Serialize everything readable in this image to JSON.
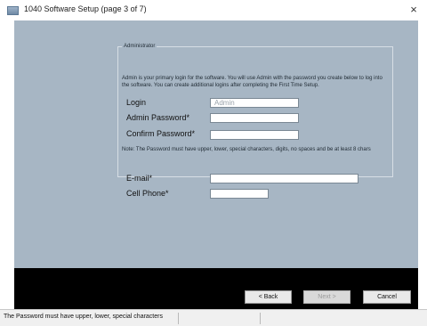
{
  "window": {
    "title": "1040 Software Setup (page 3 of 7)",
    "close_glyph": "×",
    "icon": "app-icon"
  },
  "admin_group": {
    "legend": "Administrator",
    "description": "Admin is your primary login for the software. You will use Admin with the password you create below to log into the software. You can create additional logins after completing the First Time Setup.",
    "fields": {
      "login": {
        "label": "Login",
        "placeholder": "Admin",
        "value": ""
      },
      "admin_password": {
        "label": "Admin Password*",
        "value": ""
      },
      "confirm_password": {
        "label": "Confirm Password*",
        "value": ""
      },
      "email": {
        "label": "E-mail*",
        "value": ""
      },
      "cell_phone": {
        "label": "Cell Phone*",
        "value": ""
      }
    },
    "note": "Note: The Password must have upper, lower, special characters, digits, no spaces and be at least 8 chars"
  },
  "buttons": {
    "back": "< Back",
    "next": "Next >",
    "cancel": "Cancel"
  },
  "status_bar": {
    "text": "The Password must have upper, lower, special characters"
  },
  "colors": {
    "content_bg": "#a7b6c4",
    "bottom_band": "#000000"
  }
}
